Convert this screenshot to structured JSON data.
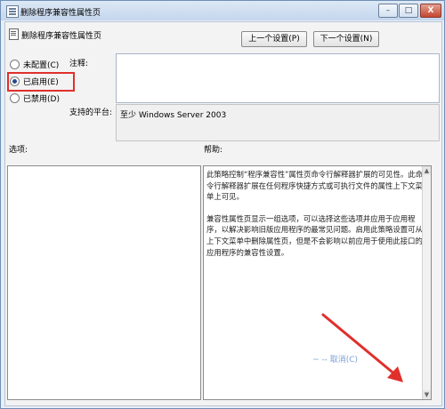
{
  "window": {
    "title": "删除程序兼容性属性页",
    "controls": {
      "minimize": "–",
      "maximize": "□",
      "close": "X"
    }
  },
  "policy": {
    "name": "删除程序兼容性属性页",
    "prev_button": "上一个设置(P)",
    "next_button": "下一个设置(N)"
  },
  "settings": {
    "options": [
      {
        "label": "未配置(C)",
        "selected": false
      },
      {
        "label": "已启用(E)",
        "selected": true
      },
      {
        "label": "已禁用(D)",
        "selected": false
      }
    ],
    "comment_label": "注释:",
    "platform_label": "支持的平台:",
    "platform_value": "至少 Windows Server 2003"
  },
  "panes": {
    "options_label": "选项:",
    "help_label": "帮助:",
    "help_paragraphs": [
      "此策略控制“程序兼容性”属性页命令行解释器扩展的可见性。此命令行解释器扩展在任何程序快捷方式或可执行文件的属性上下文菜单上可见。",
      "兼容性属性页显示一组选项，可以选择这些选项并应用于应用程序，以解决影响旧版应用程序的最常见问题。启用此策略设置可从上下文菜单中删除属性页，但是不会影响以前应用于使用此接口的应用程序的兼容性设置。"
    ]
  },
  "colors": {
    "highlight_box": "#e0302c",
    "arrow": "#e0302c",
    "radio_dot": "#254a8c"
  },
  "overlays": {
    "bottom_partial_text": "~ -- 取消(C)"
  },
  "icons": {
    "window": "policy-page-icon",
    "policy": "policy-page-icon",
    "radio": "radio-button"
  }
}
